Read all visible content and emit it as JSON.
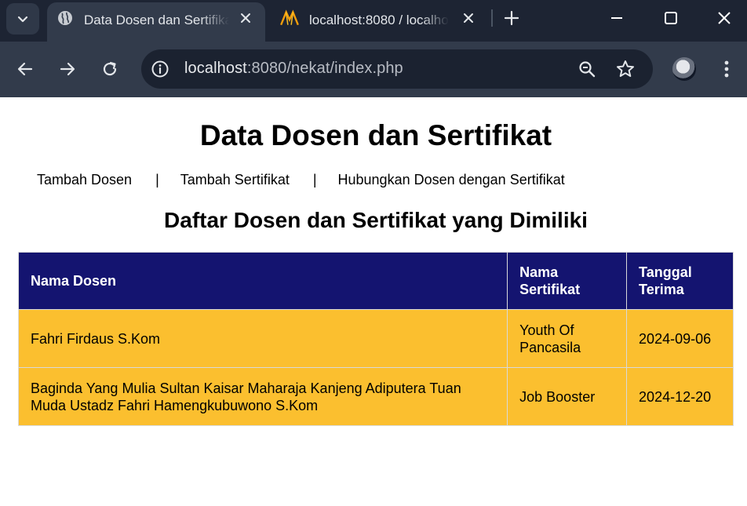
{
  "browser": {
    "tabs": [
      {
        "title": "Data Dosen dan Sertifikat",
        "active": true,
        "icon": "globe-icon"
      },
      {
        "title": "localhost:8080 / localhost",
        "active": false,
        "icon": "phpmyadmin-icon"
      }
    ],
    "url_host": "localhost",
    "url_rest": ":8080/nekat/index.php"
  },
  "page": {
    "title": "Data Dosen dan Sertifikat",
    "nav": {
      "items": [
        "Tambah Dosen",
        "Tambah Sertifikat",
        "Hubungkan Dosen dengan Sertifikat"
      ],
      "separator": "|"
    },
    "section_title": "Daftar Dosen dan Sertifikat yang Dimiliki",
    "table": {
      "headers": [
        "Nama Dosen",
        "Nama Sertifikat",
        "Tanggal Terima"
      ],
      "rows": [
        [
          "Fahri Firdaus S.Kom",
          "Youth Of Pancasila",
          "2024-09-06"
        ],
        [
          "Baginda Yang Mulia Sultan Kaisar Maharaja Kanjeng Adiputera Tuan Muda Ustadz Fahri Hamengkubuwono S.Kom",
          "Job Booster",
          "2024-12-20"
        ]
      ]
    }
  },
  "colors": {
    "header_bg": "#141470",
    "row_bg": "#fbbf2f",
    "chrome_bg": "#1d2433",
    "toolbar_bg": "#323b4b"
  }
}
